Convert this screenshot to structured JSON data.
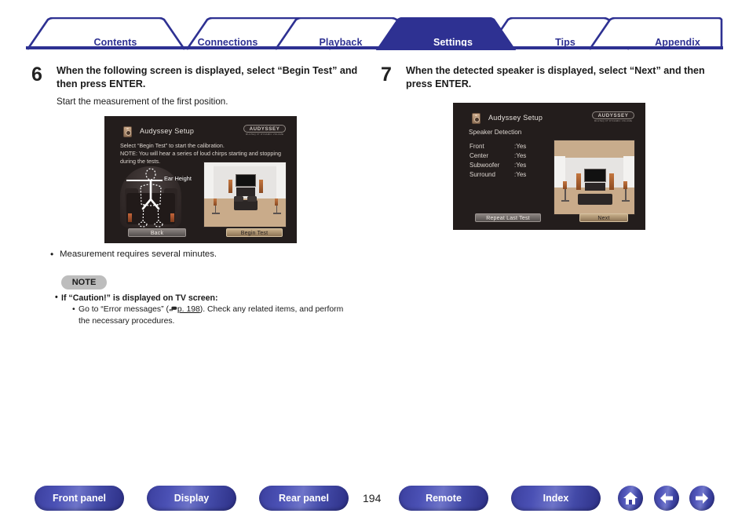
{
  "header": {
    "tabs": [
      {
        "label": "Contents",
        "active": false
      },
      {
        "label": "Connections",
        "active": false
      },
      {
        "label": "Playback",
        "active": false
      },
      {
        "label": "Settings",
        "active": true
      },
      {
        "label": "Tips",
        "active": false
      },
      {
        "label": "Appendix",
        "active": false
      }
    ],
    "accent_color": "#2e3192"
  },
  "steps": [
    {
      "number": "6",
      "title": "When the following screen is displayed, select “Begin Test” and then press ENTER.",
      "subtitle": "Start the measurement of the first position.",
      "osd": {
        "title": "Audyssey Setup",
        "logo_main": "AUDYSSEY",
        "logo_sub": "MULTEQ XT\nDYNAMIC VOLUME",
        "description": "Select “Begin Test” to start the calibration.\nNOTE: You will hear a series of loud chirps starting and stopping\nduring the tests.",
        "ear_height_label": "Ear Height",
        "button_left": "Back",
        "button_right": "Begin Test"
      }
    },
    {
      "number": "7",
      "title": "When the detected speaker is displayed, select “Next” and then press ENTER.",
      "subtitle": "",
      "osd": {
        "title": "Audyssey Setup",
        "logo_main": "AUDYSSEY",
        "logo_sub": "MULTEQ XT\nDYNAMIC VOLUME",
        "section": "Speaker Detection",
        "rows": [
          {
            "name": "Front",
            "value": ":Yes"
          },
          {
            "name": "Center",
            "value": ":Yes"
          },
          {
            "name": "Subwoofer",
            "value": ":Yes"
          },
          {
            "name": "Surround",
            "value": ":Yes"
          }
        ],
        "button_left": "Repeat Last Test",
        "button_right": "Next"
      }
    }
  ],
  "body": {
    "bullet": "Measurement requires several minutes.",
    "note_badge": "NOTE",
    "note_heading": "If “Caution!” is displayed on TV screen:",
    "note_text_before": "Go to “Error messages” (",
    "note_link": "p. 198",
    "note_text_after": "). Check any related items, and perform the necessary procedures."
  },
  "footer": {
    "buttons": [
      {
        "label": "Front panel"
      },
      {
        "label": "Display"
      },
      {
        "label": "Rear panel"
      },
      {
        "label": "Remote"
      },
      {
        "label": "Index"
      }
    ],
    "page_number": "194",
    "icons": [
      {
        "name": "home-icon"
      },
      {
        "name": "arrow-left-icon"
      },
      {
        "name": "arrow-right-icon"
      }
    ]
  }
}
